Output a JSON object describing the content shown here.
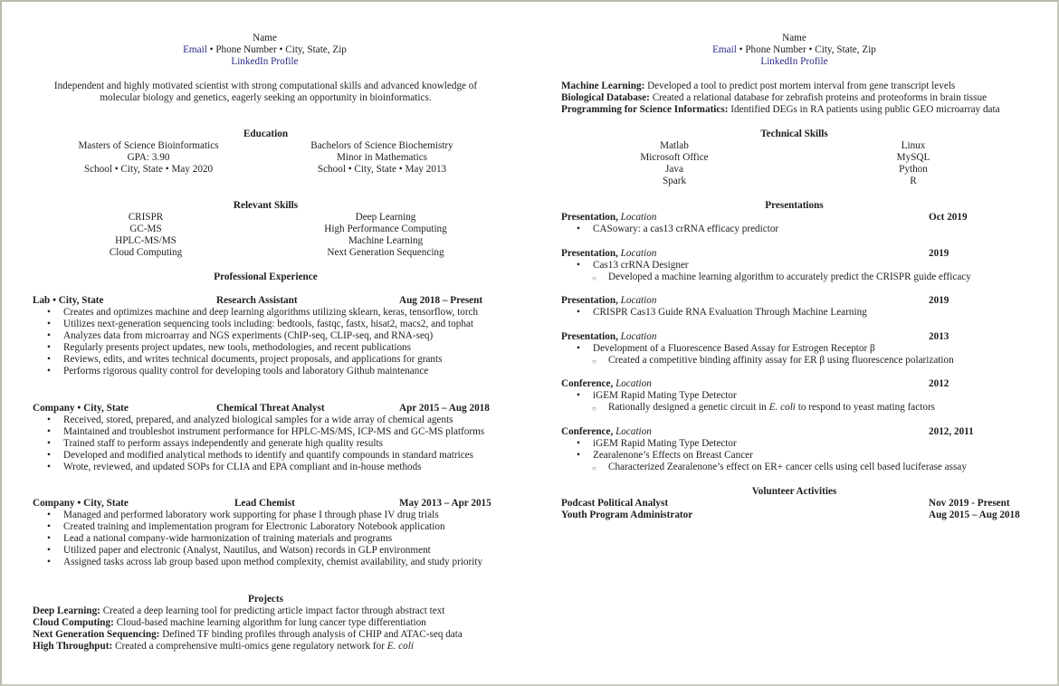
{
  "left": {
    "header": {
      "name": "Name",
      "email": "Email",
      "contact_rest": " • Phone Number • City, State, Zip",
      "linkedin": "LinkedIn Profile"
    },
    "summary": [
      "Independent and highly motivated scientist with strong computational skills and advanced knowledge of",
      "molecular biology and genetics, eagerly seeking an opportunity in bioinformatics."
    ],
    "education": {
      "title": "Education",
      "col1": [
        "Masters of Science Bioinformatics",
        "GPA: 3.90",
        "School • City, State • May 2020"
      ],
      "col2": [
        "Bachelors of Science Biochemistry",
        "Minor in Mathematics",
        "School • City, State • May 2013"
      ]
    },
    "skills": {
      "title": "Relevant Skills",
      "col1": [
        "CRISPR",
        "GC-MS",
        "HPLC-MS/MS",
        "Cloud Computing"
      ],
      "col2": [
        "Deep Learning",
        "High Performance Computing",
        "Machine Learning",
        "Next Generation Sequencing"
      ]
    },
    "experience": {
      "title": "Professional Experience",
      "jobs": [
        {
          "org": "Lab • City, State",
          "role": "Research Assistant",
          "dates": "Aug 2018 – Present",
          "bullets": [
            "Creates and optimizes machine and deep learning algorithms utilizing sklearn, keras, tensorflow, torch",
            "Utilizes next-generation sequencing tools including: bedtools, fastqc, fastx, hisat2, macs2, and tophat",
            "Analyzes data from microarray and NGS experiments (ChIP-seq, CLIP-seq, and RNA-seq)",
            "Regularly presents project updates, new tools, methodologies, and recent publications",
            "Reviews, edits, and writes technical documents, project proposals, and applications for grants",
            "Performs rigorous quality control for developing tools and laboratory Github maintenance"
          ]
        },
        {
          "org": "Company • City, State",
          "role": "Chemical Threat Analyst",
          "dates": "Apr 2015 – Aug 2018",
          "bullets": [
            "Received, stored, prepared, and analyzed biological samples for a wide array of chemical agents",
            "Maintained and troubleshot instrument performance for HPLC-MS/MS, ICP-MS and GC-MS platforms",
            "Trained staff to perform assays independently and generate high quality results",
            "Developed and modified analytical methods to identify and quantify compounds in standard matrices",
            "Wrote, reviewed, and updated SOPs for CLIA and EPA compliant and in-house methods"
          ]
        },
        {
          "org": "Company • City, State",
          "role": "Lead Chemist",
          "dates": "May 2013 – Apr 2015",
          "bullets": [
            "Managed and performed laboratory work supporting for phase I through phase IV drug trials",
            "Created training and implementation program for Electronic Laboratory Notebook application",
            "Lead a national company-wide harmonization of training materials and programs",
            "Utilized paper and electronic (Analyst, Nautilus, and Watson) records in GLP environment",
            "Assigned tasks across lab group based upon method complexity, chemist availability, and study priority"
          ]
        }
      ]
    },
    "projects": {
      "title": "Projects",
      "items": [
        {
          "label": "Deep Learning:",
          "text": " Created a deep learning tool for predicting article impact factor through abstract text",
          "italic": ""
        },
        {
          "label": "Cloud Computing:",
          "text": " Cloud-based machine learning algorithm for lung cancer type differentiation",
          "italic": ""
        },
        {
          "label": "Next Generation Sequencing:",
          "text": " Defined TF binding profiles through analysis of CHIP and ATAC-seq data",
          "italic": ""
        },
        {
          "label": "High Throughput:",
          "text": " Created a comprehensive multi-omics gene regulatory network for ",
          "italic": "E. coli"
        }
      ]
    }
  },
  "right": {
    "header": {
      "name": "Name",
      "email": "Email",
      "contact_rest": " • Phone Number • City, State, Zip",
      "linkedin": "LinkedIn Profile"
    },
    "projects": [
      {
        "label": "Machine Learning:",
        "text": " Developed a tool to predict post mortem interval from gene transcript levels"
      },
      {
        "label": "Biological Database:",
        "text": " Created a relational database for zebrafish proteins and proteoforms in brain tissue"
      },
      {
        "label": "Programming for Science Informatics:",
        "text": " Identified DEGs in RA patients using public GEO microarray data"
      }
    ],
    "tech_skills": {
      "title": "Technical Skills",
      "col1": [
        "Matlab",
        "Microsoft Office",
        "Java",
        "Spark"
      ],
      "col2": [
        "Linux",
        "MySQL",
        "Python",
        "R"
      ]
    },
    "presentations": {
      "title": "Presentations",
      "items": [
        {
          "type": "Presentation,",
          "location": "Location",
          "date": "Oct 2019",
          "bullets": [
            {
              "text": "CASowary: a cas13 crRNA efficacy predictor",
              "subs": []
            }
          ]
        },
        {
          "type": "Presentation,",
          "location": "Location",
          "date": "2019",
          "bullets": [
            {
              "text": "Cas13 crRNA Designer",
              "subs": [
                "Developed a machine learning algorithm to accurately predict the CRISPR guide efficacy"
              ]
            }
          ]
        },
        {
          "type": "Presentation,",
          "location": "Location",
          "date": "2019",
          "bullets": [
            {
              "text": "CRISPR Cas13 Guide RNA Evaluation Through Machine Learning",
              "subs": []
            }
          ]
        },
        {
          "type": "Presentation,",
          "location": "Location",
          "date": "2013",
          "bullets": [
            {
              "text": "Development of a Fluorescence Based Assay for Estrogen Receptor β",
              "subs": [
                "Created a competitive binding affinity assay for ER β using fluorescence polarization"
              ]
            }
          ]
        },
        {
          "type": "Conference,",
          "location": "Location",
          "date": "2012",
          "bullets": [
            {
              "text": "iGEM Rapid Mating Type Detector",
              "subs": []
            }
          ]
        },
        {
          "type": "Conference,",
          "location": "Location",
          "date": "2012, 2011",
          "bullets": [
            {
              "text": "iGEM Rapid Mating Type Detector",
              "subs": []
            },
            {
              "text": "Zearalenone’s Effects on Breast Cancer",
              "subs": [
                "Characterized Zearalenone’s effect on ER+ cancer cells using cell based luciferase assay"
              ]
            }
          ]
        }
      ],
      "conference1_sub": {
        "before": "Rationally designed a genetic circuit in ",
        "italic": "E. coli",
        "after": " to respond to yeast mating factors"
      }
    },
    "volunteer": {
      "title": "Volunteer Activities",
      "items": [
        {
          "role": "Podcast Political Analyst",
          "dates": "Nov 2019 - Present"
        },
        {
          "role": "Youth Program Administrator",
          "dates": "Aug 2015 – Aug 2018"
        }
      ]
    }
  },
  "symbols": {
    "bullet": "•",
    "sub_bullet": "○"
  }
}
